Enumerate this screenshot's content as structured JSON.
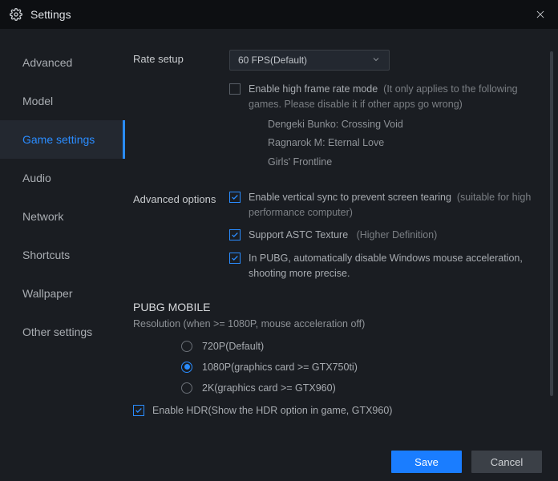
{
  "window": {
    "title": "Settings"
  },
  "sidebar": {
    "items": [
      {
        "label": "Advanced"
      },
      {
        "label": "Model"
      },
      {
        "label": "Game settings"
      },
      {
        "label": "Audio"
      },
      {
        "label": "Network"
      },
      {
        "label": "Shortcuts"
      },
      {
        "label": "Wallpaper"
      },
      {
        "label": "Other settings"
      }
    ],
    "active_index": 2
  },
  "rate_setup": {
    "label": "Rate setup",
    "selected": "60 FPS(Default)",
    "high_frame": {
      "checked": false,
      "text": "Enable high frame rate mode",
      "note": "(It only applies to the following games. Please disable it if other apps go wrong)",
      "games": [
        "Dengeki Bunko: Crossing Void",
        "Ragnarok M: Eternal Love",
        "Girls' Frontline"
      ]
    }
  },
  "advanced_options": {
    "label": "Advanced options",
    "vsync": {
      "checked": true,
      "text": "Enable vertical sync to prevent screen tearing",
      "note": "(suitable for high performance computer)"
    },
    "astc": {
      "checked": true,
      "text": "Support ASTC Texture",
      "note": "(Higher Definition)"
    },
    "pubg_mouse": {
      "checked": true,
      "text": "In PUBG, automatically disable Windows mouse acceleration, shooting more precise."
    }
  },
  "pubg_mobile": {
    "header": "PUBG MOBILE",
    "resolution_label": "Resolution (when >= 1080P, mouse acceleration off)",
    "options": [
      {
        "label": "720P(Default)"
      },
      {
        "label": "1080P(graphics card >= GTX750ti)"
      },
      {
        "label": "2K(graphics card >= GTX960)"
      }
    ],
    "selected_index": 1,
    "hdr": {
      "checked": true,
      "text": "Enable HDR(Show the HDR option in game, GTX960)"
    }
  },
  "footer": {
    "save": "Save",
    "cancel": "Cancel"
  }
}
